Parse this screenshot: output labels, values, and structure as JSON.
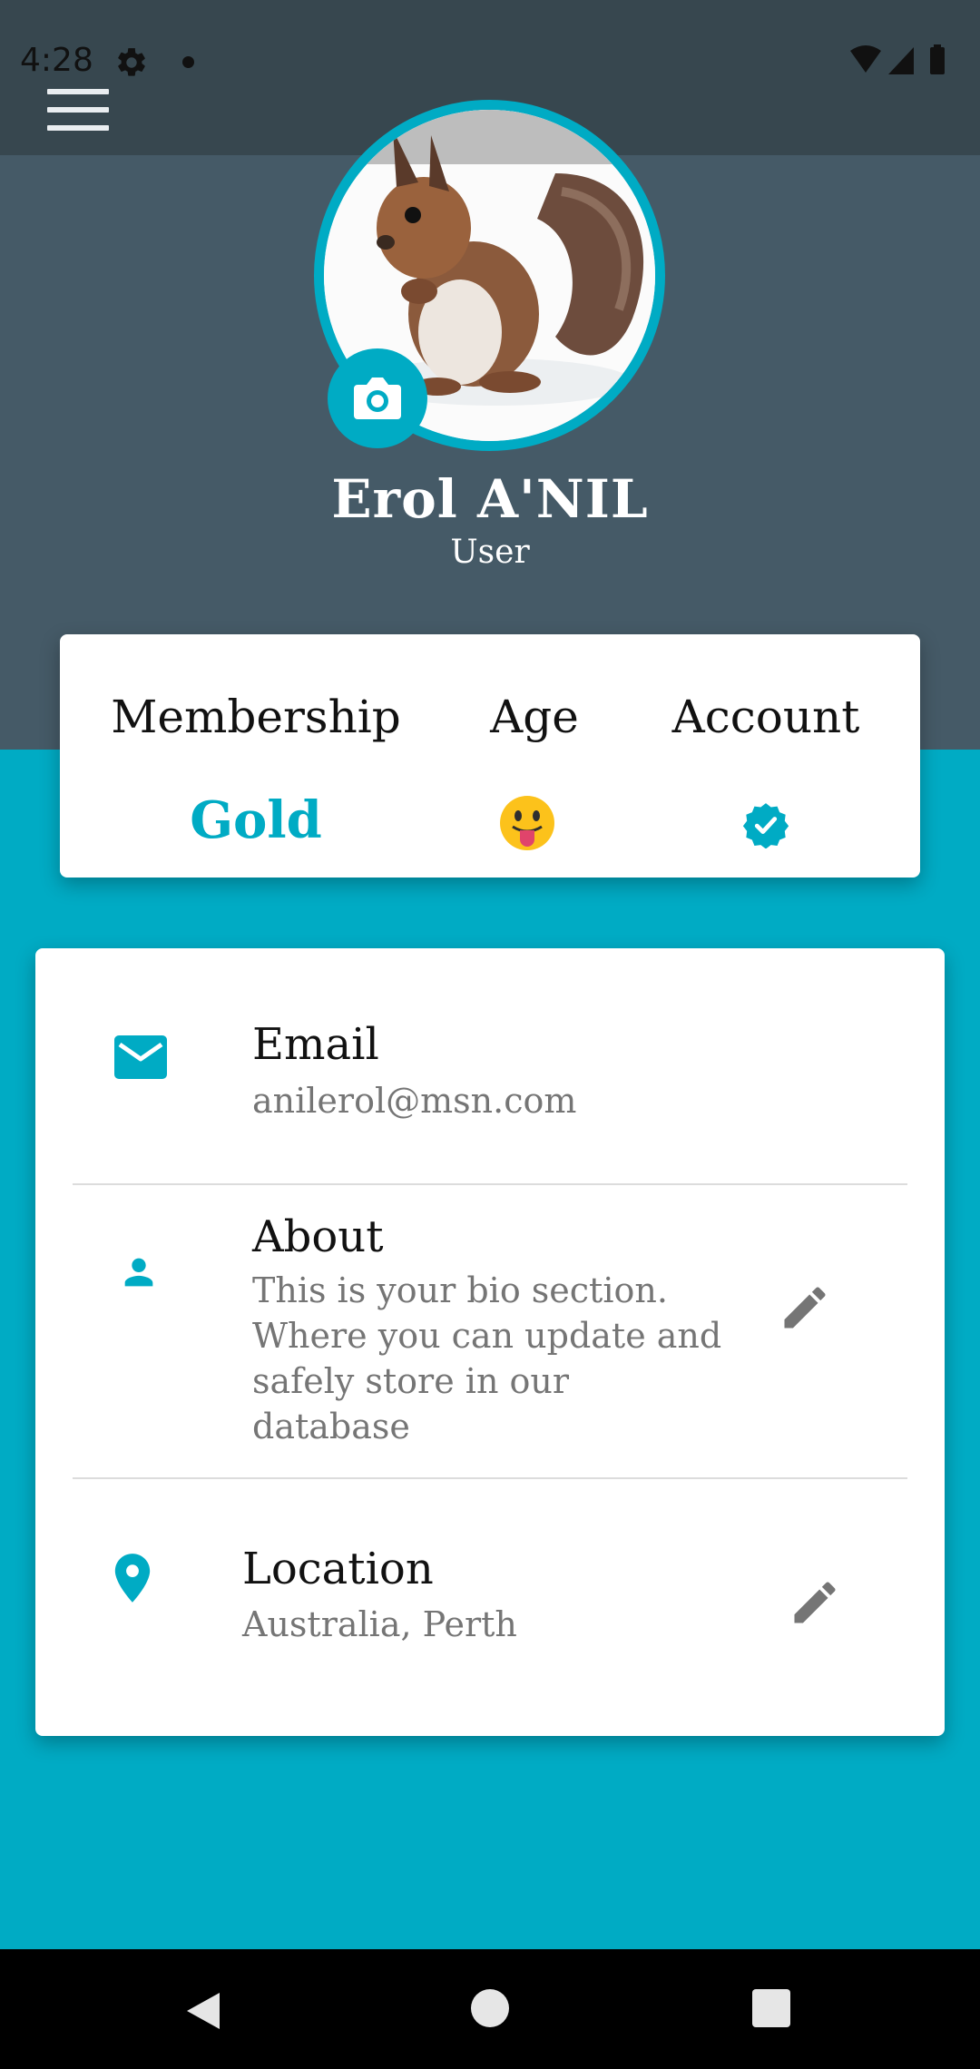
{
  "status_bar": {
    "time": "4:28"
  },
  "profile": {
    "name": "Erol A'NIL",
    "role": "User"
  },
  "stats": {
    "membership_label": "Membership",
    "membership_value": "Gold",
    "age_label": "Age",
    "age_icon": "tongue-out-emoji",
    "account_label": "Account",
    "account_icon": "verified-badge-icon"
  },
  "info": {
    "email": {
      "title": "Email",
      "value": "anilerol@msn.com",
      "icon": "email-icon"
    },
    "about": {
      "title": "About",
      "value": "This is your bio section. Where you can update and safely store in our database",
      "icon": "person-icon"
    },
    "location": {
      "title": "Location",
      "value": "Australia, Perth",
      "icon": "location-pin-icon"
    }
  },
  "colors": {
    "accent": "#00abc4",
    "header": "#455a67",
    "status_bar": "#37474f"
  }
}
